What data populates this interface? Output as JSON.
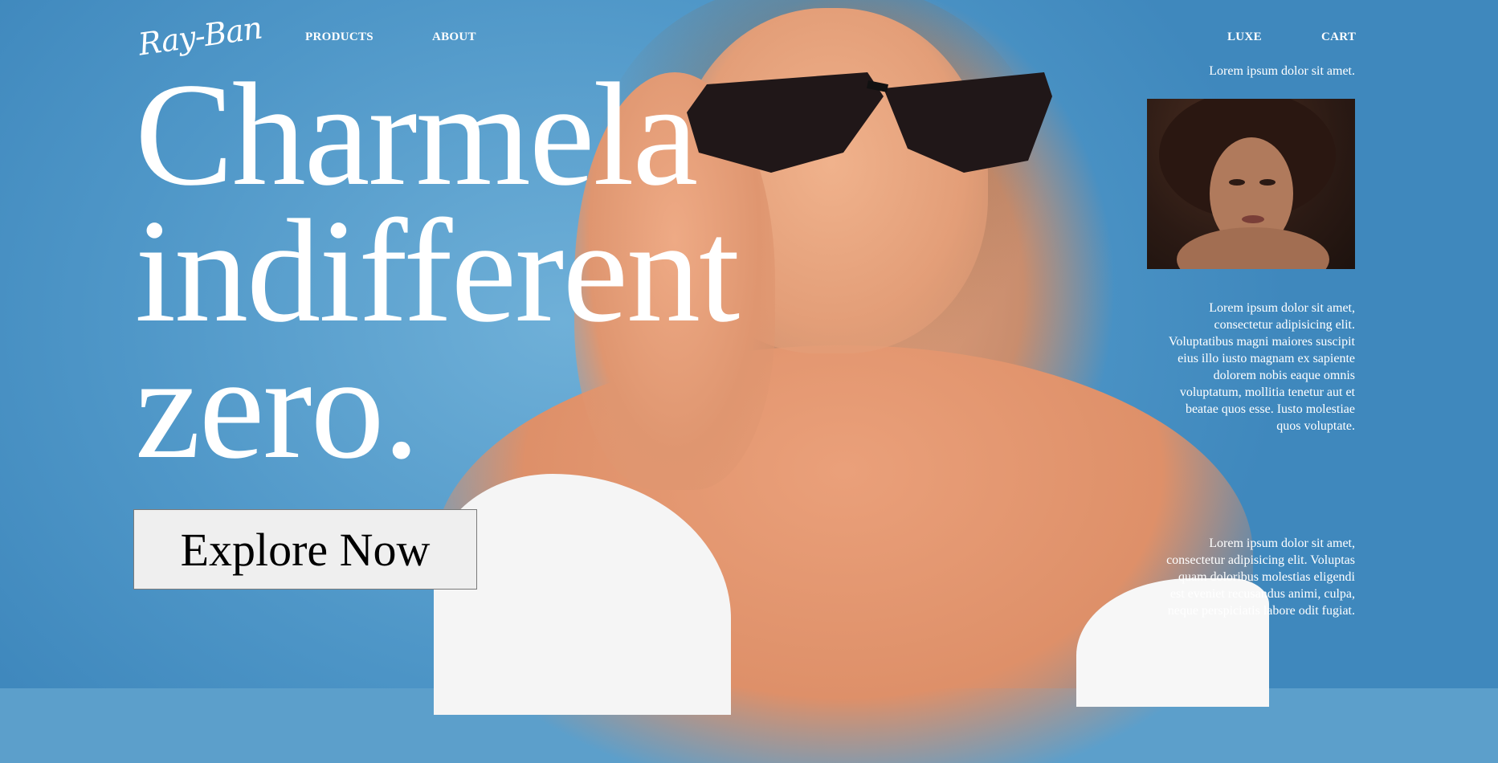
{
  "brand": {
    "logo_text": "Ray-Ban"
  },
  "nav": {
    "products": "PRODUCTS",
    "about": "ABOUT",
    "luxe": "LUXE",
    "cart": "CART"
  },
  "hero": {
    "line1": "Charmela",
    "line2": "indifferent",
    "line3": "zero.",
    "cta_label": "Explore Now"
  },
  "sidebar": {
    "tagline": "Lorem ipsum dolor sit amet.",
    "thumbnail_alt": "Portrait of a woman with curly hair",
    "paragraph1_lines": [
      "Lorem ipsum dolor sit amet,",
      "consectetur adipisicing elit.",
      "Voluptatibus magni maiores suscipit",
      "eius illo iusto magnam ex sapiente",
      "dolorem nobis eaque omnis",
      "voluptatum, mollitia tenetur aut et",
      "beatae quos esse. Iusto molestiae",
      "quos voluptate."
    ],
    "paragraph2_lines": [
      "Lorem ipsum dolor sit amet,",
      "consectetur adipisicing elit. Voluptas",
      "quam doloribus molestias eligendi",
      "est eveniet recusandus animi, culpa,",
      "neque perspiciatis labore odit fugiat."
    ]
  },
  "colors": {
    "background_blue": "#5c9fcb",
    "text_white": "#ffffff",
    "button_bg": "#efefef"
  }
}
